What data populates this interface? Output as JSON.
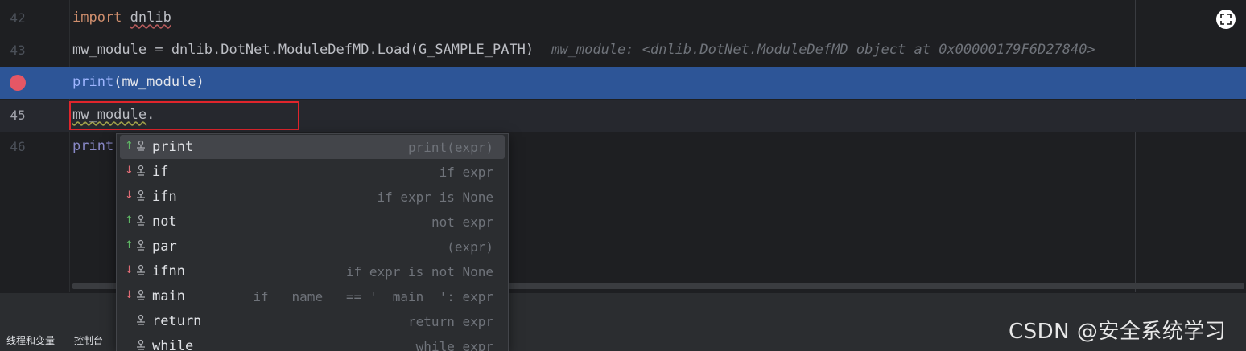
{
  "editor": {
    "lines": [
      {
        "number": "42",
        "keyword": "import",
        "module": "dnlib"
      },
      {
        "number": "43",
        "code": "mw_module = dnlib.DotNet.ModuleDefMD.Load(G_SAMPLE_PATH)",
        "inlay": "mw_module: <dnlib.DotNet.ModuleDefMD object at 0x00000179F6D27840>"
      },
      {
        "func": "print",
        "args": "(mw_module)"
      },
      {
        "number": "45",
        "ident": "mw_module",
        "suffix": "."
      },
      {
        "number": "46",
        "func": "print"
      }
    ]
  },
  "completion": {
    "items": [
      {
        "name": "print",
        "desc": "print(expr)",
        "direction": "up"
      },
      {
        "name": "if",
        "desc": "if expr",
        "direction": "down"
      },
      {
        "name": "ifn",
        "desc": "if expr is None",
        "direction": "down"
      },
      {
        "name": "not",
        "desc": "not expr",
        "direction": "up"
      },
      {
        "name": "par",
        "desc": "(expr)",
        "direction": "up"
      },
      {
        "name": "ifnn",
        "desc": "if expr is not None",
        "direction": "down"
      },
      {
        "name": "main",
        "desc": "if __name__ == '__main__': expr",
        "direction": "down"
      },
      {
        "name": "return",
        "desc": "return expr",
        "direction": ""
      },
      {
        "name": "while",
        "desc": "while expr",
        "direction": ""
      }
    ],
    "arrow_up": "↑",
    "arrow_down": "↓"
  },
  "bottom_tabs": {
    "threads": "线程和变量",
    "console": "控制台"
  },
  "watermark": "CSDN @安全系统学习",
  "colors": {
    "selection": "#2d5597",
    "breakpoint": "#e55765",
    "annotation_box": "#e0252c"
  }
}
